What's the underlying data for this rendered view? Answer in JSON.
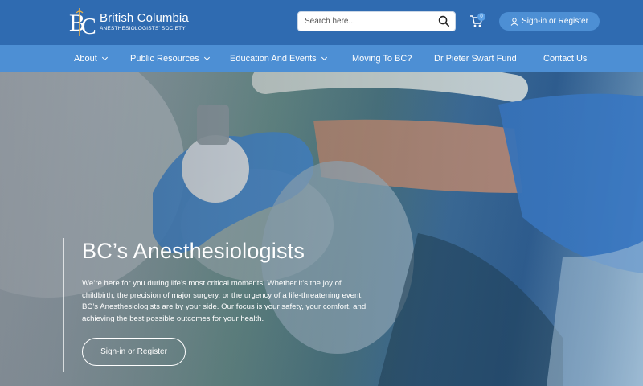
{
  "header": {
    "logo_title": "British Columbia",
    "logo_subtitle": "ANESTHESIOLOGISTS' SOCIETY",
    "search_placeholder": "Search here...",
    "cart_count": "0",
    "signin_label": "Sign-in or Register"
  },
  "nav": {
    "items": [
      {
        "label": "About"
      },
      {
        "label": "Public Resources"
      },
      {
        "label": "Education And Events"
      },
      {
        "label": "Moving To BC?"
      },
      {
        "label": "Dr Pieter Swart Fund"
      },
      {
        "label": "Contact Us"
      }
    ]
  },
  "hero": {
    "title": "BC’s Anesthesiologists",
    "text": "We’re here for you during life’s most critical moments. Whether it’s the joy of childbirth, the precision of major surgery, or the urgency of a life-threatening event, BC’s Anesthesiologists are by your side. Our focus is your safety, your comfort, and achieving the best possible outcomes for your health.",
    "button_label": "Sign-in or Register"
  },
  "colors": {
    "header_bg": "#2f6bb1",
    "nav_bg": "#4d8fd4",
    "logo_accent": "#e8b04a"
  }
}
